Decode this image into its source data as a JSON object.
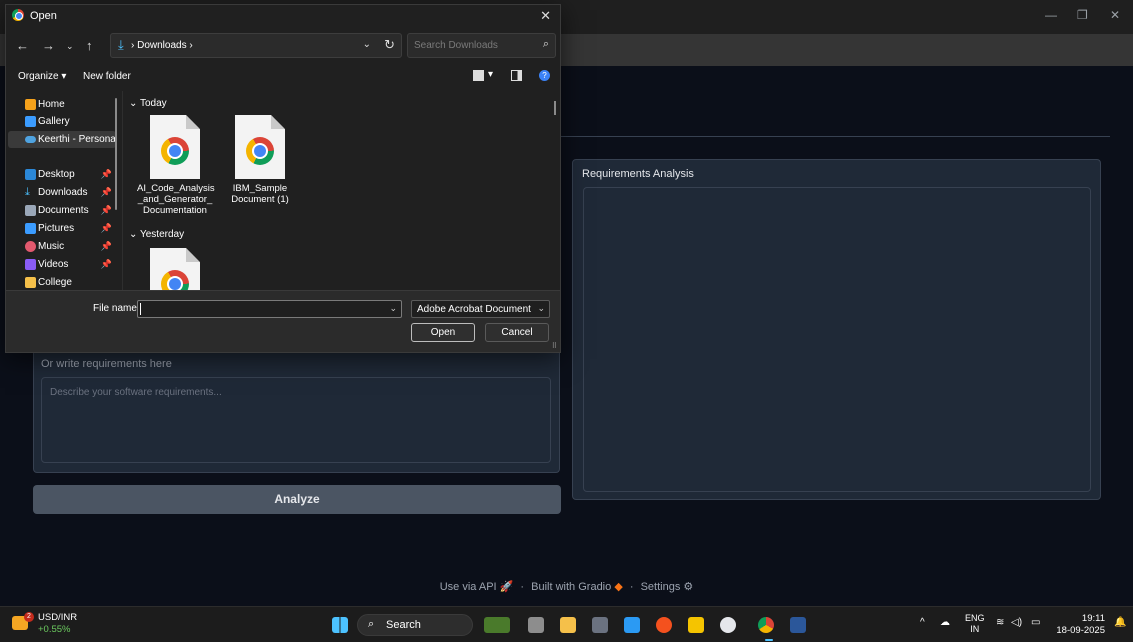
{
  "app": {
    "requirements_label": "Requirements Analysis",
    "write_label": "Or write requirements here",
    "write_placeholder": "Describe your software requirements...",
    "analyze_label": "Analyze",
    "footer": {
      "api": "Use via API",
      "built": "Built with Gradio",
      "settings": "Settings"
    }
  },
  "dialog": {
    "title": "Open",
    "path": "Downloads",
    "search_placeholder": "Search Downloads",
    "organize": "Organize",
    "new_folder": "New folder",
    "nav_items": [
      {
        "label": "Home"
      },
      {
        "label": "Gallery"
      },
      {
        "label": "Keerthi - Personal"
      },
      {
        "label": "Desktop"
      },
      {
        "label": "Downloads"
      },
      {
        "label": "Documents"
      },
      {
        "label": "Pictures"
      },
      {
        "label": "Music"
      },
      {
        "label": "Videos"
      },
      {
        "label": "College"
      }
    ],
    "groups": {
      "today": "Today",
      "yesterday": "Yesterday"
    },
    "files": [
      {
        "name_l1": "AI_Code_Analysis",
        "name_l2": "_and_Generator_",
        "name_l3": "Documentation"
      },
      {
        "name_l1": "IBM_Sample",
        "name_l2": "Document (1)",
        "name_l3": ""
      }
    ],
    "file_name_label": "File name:",
    "file_name_value": "",
    "file_type": "Adobe Acrobat Document",
    "open_label": "Open",
    "cancel_label": "Cancel"
  },
  "taskbar": {
    "stock_symbol": "USD/INR",
    "stock_change": "+0.55%",
    "stock_badge": "2",
    "search_label": "Search",
    "lang_top": "ENG",
    "lang_bottom": "IN",
    "time": "19:11",
    "date": "18-09-2025"
  },
  "colors": {
    "bg": "#0b0f19",
    "panel": "#1f2937",
    "border": "#374151",
    "analyze_btn": "#4b5563",
    "dialog_bg": "#202020",
    "accent": "#4cc2ff"
  }
}
